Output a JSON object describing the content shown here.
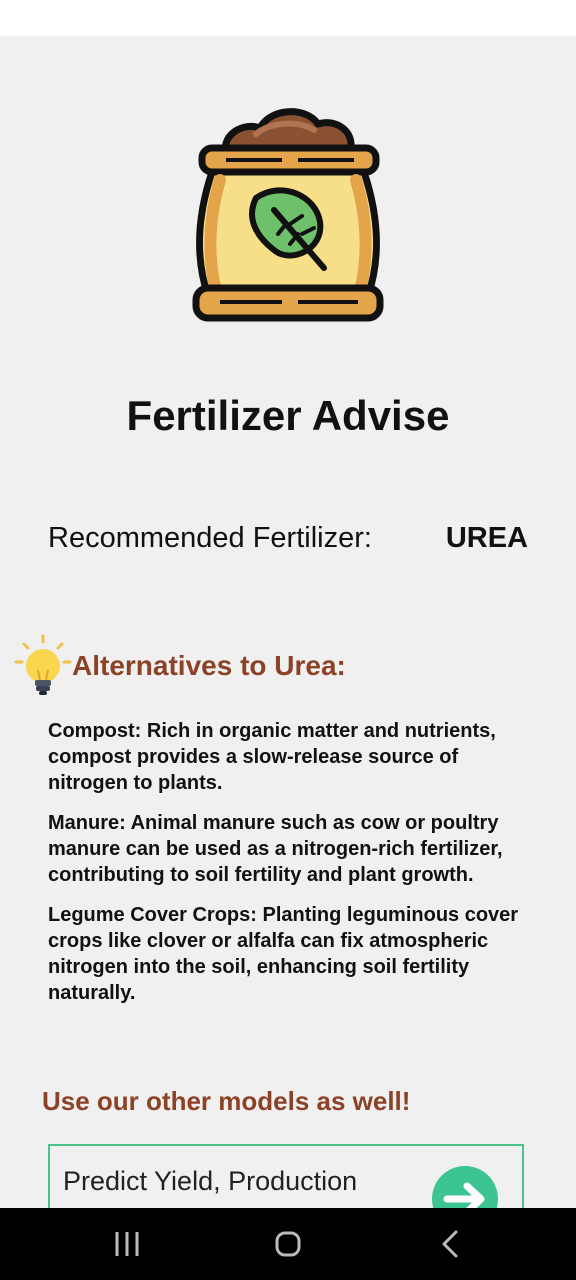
{
  "page": {
    "title": "Fertilizer Advise",
    "recommended_label": "Recommended Fertilizer:",
    "recommended_value": "UREA"
  },
  "alternatives": {
    "heading": "Alternatives to Urea:",
    "items": [
      "Compost: Rich in organic matter and nutrients, compost provides a slow-release source of nitrogen to plants.",
      "Manure: Animal manure such as cow or poultry manure can be used as a nitrogen-rich fertilizer, contributing to soil fertility and plant growth.",
      "Legume Cover Crops: Planting leguminous cover crops like clover or alfalfa can fix atmospheric nitrogen into the soil, enhancing soil fertility naturally."
    ]
  },
  "models": {
    "heading": "Use our other models as well!",
    "card_label": "Predict Yield, Production"
  },
  "icons": {
    "hero": "fertilizer-bag-icon",
    "alternatives": "lightbulb-icon",
    "model_go": "arrow-right-icon",
    "nav": [
      "recent-apps-icon",
      "home-icon",
      "back-icon"
    ]
  },
  "colors": {
    "accent_heading": "#8b4226",
    "card_border": "#4cc38a",
    "go_button": "#3cc592",
    "background": "#f0f0f0"
  }
}
